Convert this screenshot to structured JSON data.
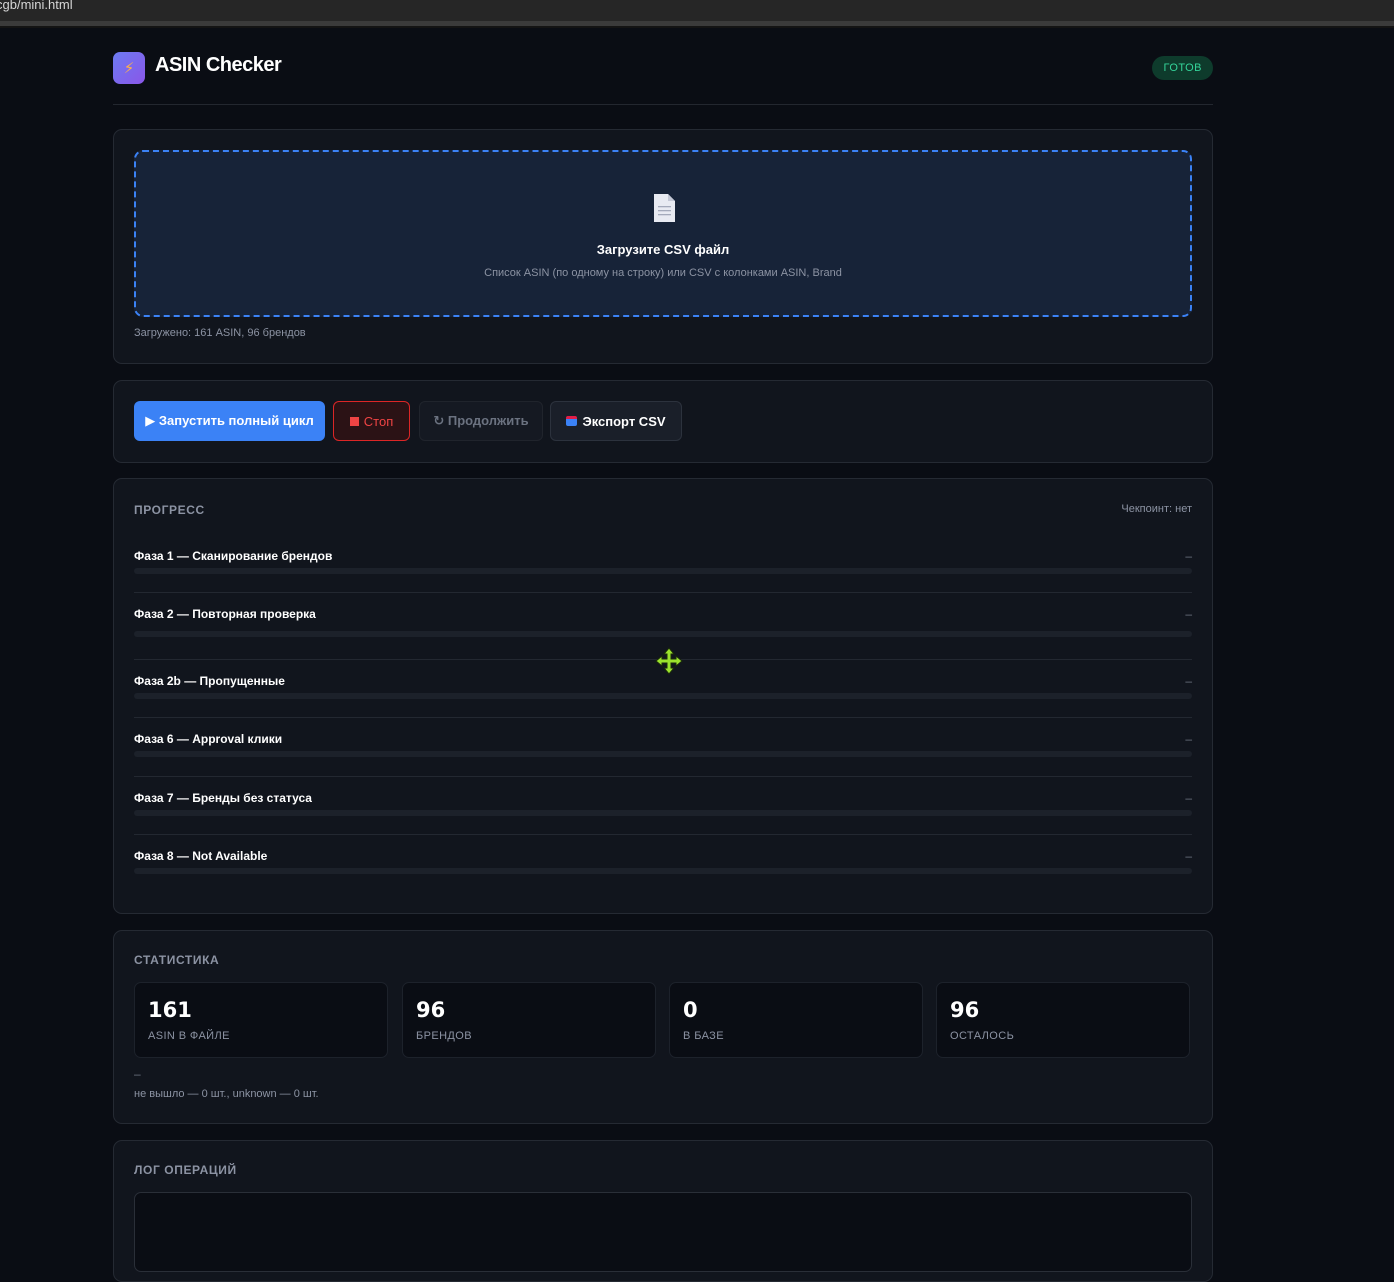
{
  "browser": {
    "url_fragment": "cgb/mini.html"
  },
  "header": {
    "logo_icon": "lightning-icon",
    "title": "ASIN Checker",
    "status": "ГОТОВ"
  },
  "upload": {
    "icon": "document-icon",
    "title": "Загрузите CSV файл",
    "hint": "Список ASIN (по одному на строку) или CSV с колонками ASIN, Brand",
    "loaded": "Загружено: 161 ASIN, 96 брендов"
  },
  "actions": {
    "run": "▶ Запустить полный цикл",
    "stop": "Стоп",
    "resume": "↻ Продолжить",
    "export": "Экспорт CSV"
  },
  "progress": {
    "title": "ПРОГРЕСС",
    "checkpoint": "Чекпоинт: нет",
    "phases": [
      {
        "name": "Фаза 1 — Сканирование брендов",
        "value": "–",
        "fill": 0
      },
      {
        "name": "Фаза 2 — Повторная проверка",
        "value": "–",
        "fill": 0
      },
      {
        "name": "Фаза 2b — Пропущенные",
        "value": "–",
        "fill": 0
      },
      {
        "name": "Фаза 6 — Approval клики",
        "value": "–",
        "fill": 0
      },
      {
        "name": "Фаза 7 — Бренды без статуса",
        "value": "–",
        "fill": 0
      },
      {
        "name": "Фаза 8 — Not Available",
        "value": "–",
        "fill": 0
      }
    ]
  },
  "stats": {
    "title": "СТАТИСТИКА",
    "items": [
      {
        "value": "161",
        "label": "ASIN В ФАЙЛЕ"
      },
      {
        "value": "96",
        "label": "БРЕНДОВ"
      },
      {
        "value": "0",
        "label": "В БАЗЕ"
      },
      {
        "value": "96",
        "label": "ОСТАЛОСЬ"
      }
    ],
    "dash": "–",
    "note": "не вышло — 0 шт., unknown — 0 шт."
  },
  "log": {
    "title": "ЛОГ ОПЕРАЦИЙ"
  },
  "colors": {
    "accent": "#3b82f6",
    "danger": "#ef4444",
    "success": "#34d399",
    "background": "#0a0d14",
    "card": "#11151d"
  }
}
